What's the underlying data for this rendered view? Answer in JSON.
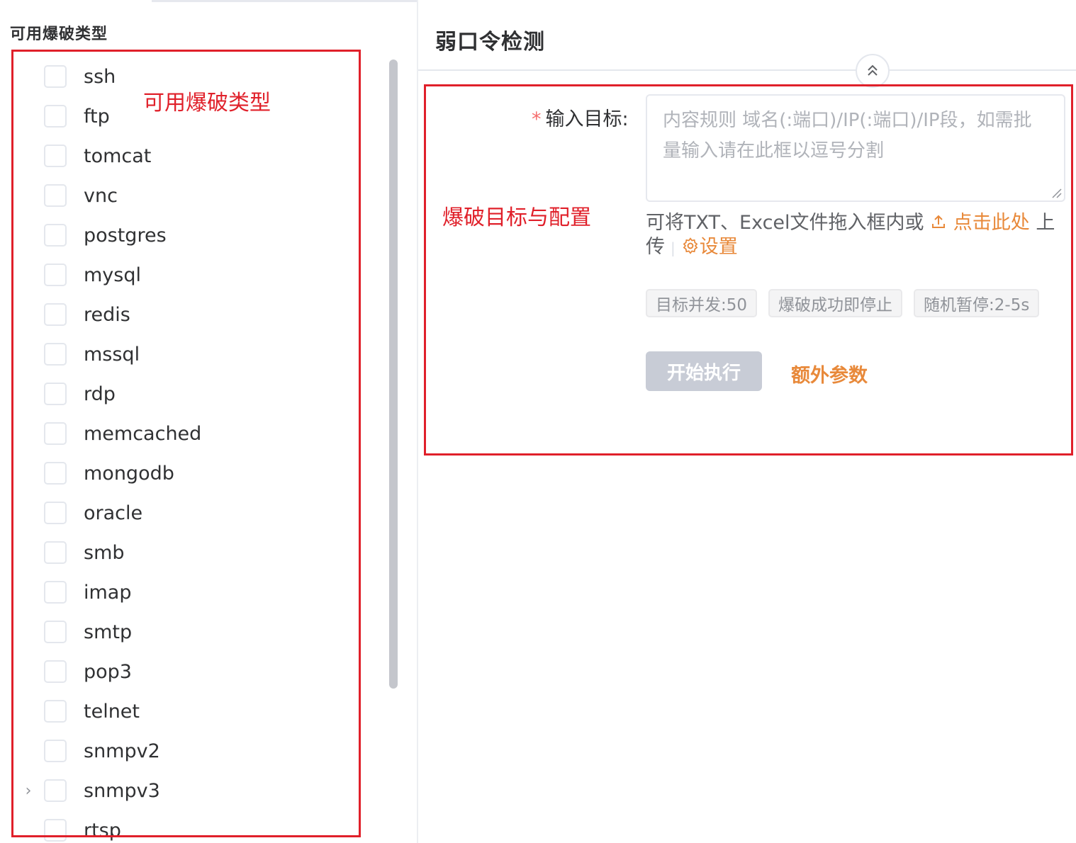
{
  "left": {
    "title": "可用爆破类型",
    "annotation": "可用爆破类型",
    "types": [
      {
        "label": "ssh"
      },
      {
        "label": "ftp"
      },
      {
        "label": "tomcat"
      },
      {
        "label": "vnc"
      },
      {
        "label": "postgres"
      },
      {
        "label": "mysql"
      },
      {
        "label": "redis"
      },
      {
        "label": "mssql"
      },
      {
        "label": "rdp"
      },
      {
        "label": "memcached"
      },
      {
        "label": "mongodb"
      },
      {
        "label": "oracle"
      },
      {
        "label": "smb"
      },
      {
        "label": "imap"
      },
      {
        "label": "smtp"
      },
      {
        "label": "pop3"
      },
      {
        "label": "telnet"
      },
      {
        "label": "snmpv2"
      },
      {
        "label": "snmpv3",
        "expandable": true
      },
      {
        "label": "rtsp"
      }
    ]
  },
  "right": {
    "title": "弱口令检测",
    "annotation": "爆破目标与配置",
    "target": {
      "required_mark": "*",
      "label": "输入目标:",
      "value": "",
      "placeholder": "内容规则 域名(:端口)/IP(:端口)/IP段，如需批量输入请在此框以逗号分割"
    },
    "hint": {
      "text": "可将TXT、Excel文件拖入框内或",
      "upload_icon": "upload-icon",
      "upload_link": "点击此处",
      "suffix": "上传",
      "separator": "|",
      "settings_icon": "gear-icon",
      "settings_link": "设置"
    },
    "tags": [
      "目标并发:50",
      "爆破成功即停止",
      "随机暂停:2-5s"
    ],
    "start_button": "开始执行",
    "extra_params": "额外参数"
  }
}
